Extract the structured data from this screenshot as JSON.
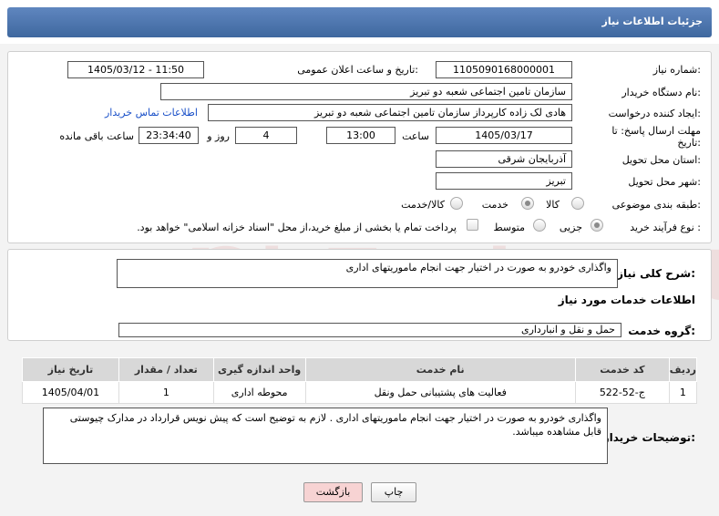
{
  "header": {
    "title": "جزئیات اطلاعات نیاز"
  },
  "form": {
    "need_number_label": "شماره نیاز:",
    "need_number": "1105090168000001",
    "announce_label": "تاریخ و ساعت اعلان عمومی:",
    "announce_value": "1405/03/12 - 11:50",
    "buyer_org_label": "نام دستگاه خریدار:",
    "buyer_org": "سازمان تامین اجتماعی شعبه دو تبریز",
    "creator_label": "ایجاد کننده درخواست:",
    "creator": "هادی لک زاده کارپرداز سازمان تامین اجتماعی شعبه دو تبریز",
    "contact_link": "اطلاعات تماس خریدار",
    "deadline_label_line1": "مهلت ارسال پاسخ: تا",
    "deadline_label_line2": "تاریخ:",
    "deadline_date": "1405/03/17",
    "time_label": "ساعت",
    "deadline_time": "13:00",
    "days_value": "4",
    "days_label": "روز و",
    "remaining_time": "23:34:40",
    "remaining_label": "ساعت باقی مانده",
    "province_label": "استان محل تحویل:",
    "province": "آذربایجان شرقی",
    "city_label": "شهر محل تحویل:",
    "city": "تبریز",
    "category_label": "طبقه بندی موضوعی:",
    "category_options": [
      "کالا",
      "خدمت",
      "کالا/خدمت"
    ],
    "category_selected": "خدمت",
    "process_label": "نوع فرآیند خرید :",
    "process_options": [
      "جزیی",
      "متوسط"
    ],
    "process_selected": "جزیی",
    "treasury_text": "پرداخت تمام یا بخشی از مبلغ خرید،از محل \"اسناد خزانه اسلامی\" خواهد بود."
  },
  "description": {
    "label": "شرح کلی نیاز:",
    "value": "واگذاری خودرو به صورت در اختیار جهت انجام ماموریتهای اداری"
  },
  "services": {
    "section_title": "اطلاعات خدمات مورد نیاز",
    "group_label": "گروه خدمت:",
    "group_value": "حمل و نقل و انبارداری",
    "columns": [
      "ردیف",
      "کد خدمت",
      "نام خدمت",
      "واحد اندازه گیری",
      "تعداد / مقدار",
      "تاریخ نیاز"
    ],
    "rows": [
      {
        "row": "1",
        "code": "ج-52-522",
        "name": "فعالیت های پشتیبانی حمل ونقل",
        "unit": "محوطه اداری",
        "qty": "1",
        "date": "1405/04/01"
      }
    ]
  },
  "buyer_notes": {
    "label": "توضیحات خریدار:",
    "value": "واگذاری خودرو به صورت در اختیار جهت انجام ماموریتهای اداری . لازم به توضیح است که پیش نویس قرارداد در مدارک چیوستی قابل مشاهده میباشد."
  },
  "buttons": {
    "print": "چاپ",
    "back": "بازگشت"
  },
  "watermark": {
    "text": "AriaTender.net"
  },
  "colors": {
    "header": "#4b74ad",
    "link": "#1a50c8",
    "back_button": "#f7d3d3"
  }
}
